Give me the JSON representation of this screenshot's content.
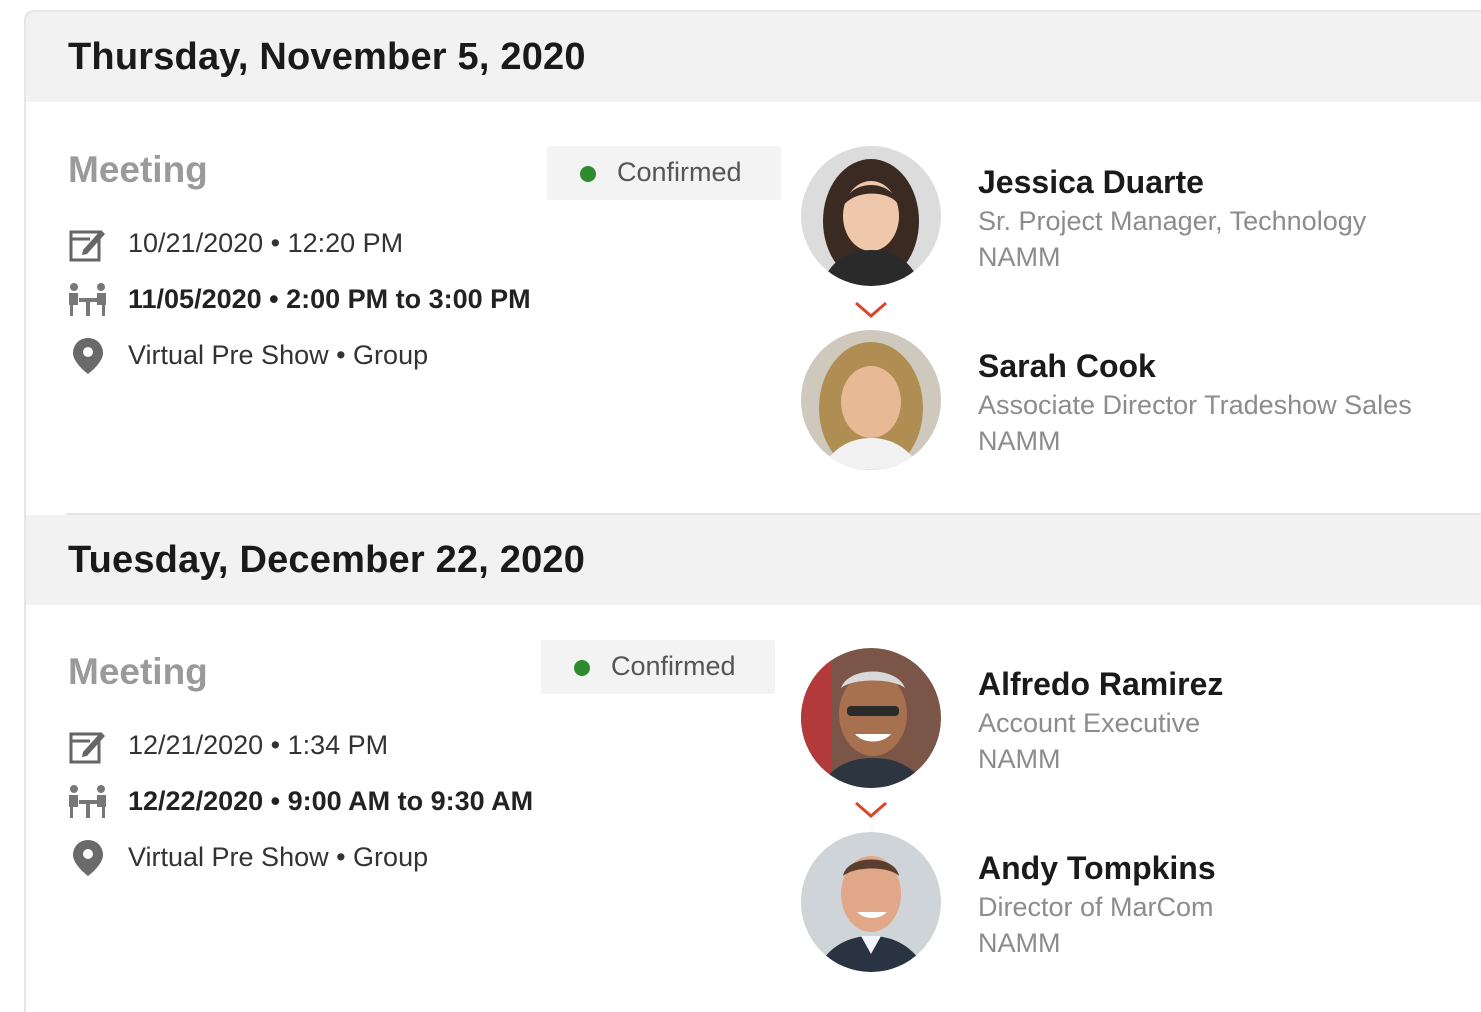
{
  "meetings": [
    {
      "date_header": "Thursday, November 5, 2020",
      "type_label": "Meeting",
      "status": "Confirmed",
      "status_color": "#2e8b2e",
      "created": "10/21/2020 • 12:20 PM",
      "scheduled": "11/05/2020 • 2:00 PM to 3:00 PM",
      "location": "Virtual Pre Show • Group",
      "icons": [
        "calendar-edit-icon",
        "meeting-table-icon",
        "location-pin-icon",
        "chevron-down-icon"
      ],
      "people": [
        {
          "name": "Jessica Duarte",
          "title": "Sr. Project Manager, Technology",
          "org": "NAMM"
        },
        {
          "name": "Sarah Cook",
          "title": "Associate Director Tradeshow Sales",
          "org": "NAMM"
        }
      ]
    },
    {
      "date_header": "Tuesday, December 22, 2020",
      "type_label": "Meeting",
      "status": "Confirmed",
      "status_color": "#2e8b2e",
      "created": "12/21/2020 • 1:34 PM",
      "scheduled": "12/22/2020 • 9:00 AM to 9:30 AM",
      "location": "Virtual Pre Show • Group",
      "icons": [
        "calendar-edit-icon",
        "meeting-table-icon",
        "location-pin-icon",
        "chevron-down-icon"
      ],
      "people": [
        {
          "name": "Alfredo Ramirez",
          "title": "Account Executive",
          "org": "NAMM"
        },
        {
          "name": "Andy Tompkins",
          "title": "Director of MarCom",
          "org": "NAMM"
        }
      ]
    }
  ],
  "accent_color": "#d9472b"
}
